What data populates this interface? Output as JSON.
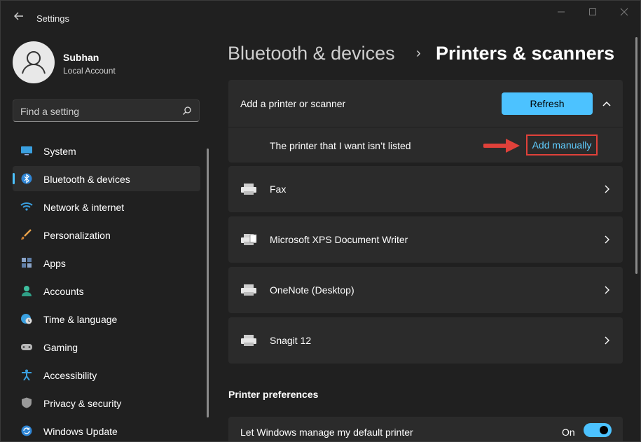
{
  "window": {
    "title": "Settings"
  },
  "profile": {
    "name": "Subhan",
    "account": "Local Account"
  },
  "search": {
    "placeholder": "Find a setting"
  },
  "nav": {
    "items": [
      {
        "label": "System",
        "icon": "monitor-icon"
      },
      {
        "label": "Bluetooth & devices",
        "icon": "bluetooth-icon",
        "active": true
      },
      {
        "label": "Network & internet",
        "icon": "wifi-icon"
      },
      {
        "label": "Personalization",
        "icon": "brush-icon"
      },
      {
        "label": "Apps",
        "icon": "apps-icon"
      },
      {
        "label": "Accounts",
        "icon": "person-icon"
      },
      {
        "label": "Time & language",
        "icon": "globe-clock-icon"
      },
      {
        "label": "Gaming",
        "icon": "gamepad-icon"
      },
      {
        "label": "Accessibility",
        "icon": "accessibility-icon"
      },
      {
        "label": "Privacy & security",
        "icon": "shield-icon"
      },
      {
        "label": "Windows Update",
        "icon": "update-icon"
      }
    ]
  },
  "header": {
    "breadcrumb": "Bluetooth & devices",
    "separator": "›",
    "title": "Printers & scanners"
  },
  "add_printer": {
    "label": "Add a printer or scanner",
    "refresh_label": "Refresh",
    "not_listed_label": "The printer that I want isn’t listed",
    "add_manually_label": "Add manually"
  },
  "printers": [
    {
      "name": "Fax"
    },
    {
      "name": "Microsoft XPS Document Writer"
    },
    {
      "name": "OneNote (Desktop)"
    },
    {
      "name": "Snagit 12"
    }
  ],
  "preferences": {
    "section_title": "Printer preferences",
    "default_printer_label": "Let Windows manage my default printer",
    "toggle_state": "On"
  },
  "colors": {
    "accent": "#4cc2ff",
    "link": "#60cdff",
    "highlight_red": "#e0413a",
    "background": "#202020",
    "card": "#2b2b2b"
  }
}
